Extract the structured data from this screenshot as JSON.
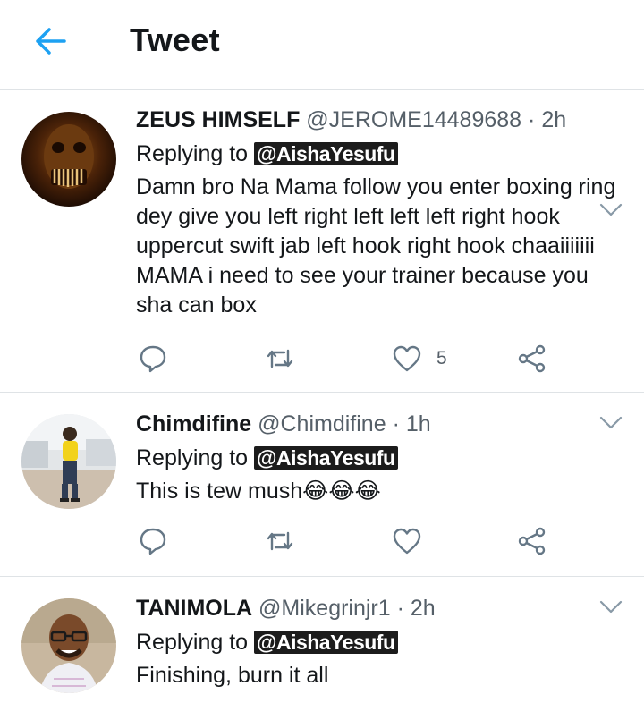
{
  "header": {
    "title": "Tweet"
  },
  "tweets": [
    {
      "name": "ZEUS HIMSELF",
      "handle": "@JEROME14489688",
      "separator": "·",
      "time": "2h",
      "replying_label": "Replying to",
      "replying_to": "@AishaYesufu",
      "text": "Damn bro Na Mama follow you enter boxing ring dey give you left right left left left right hook uppercut swift jab left hook right hook chaaiiiiiii MAMA i need to see your trainer because you sha can box",
      "like_count": "5"
    },
    {
      "name": "Chimdifine",
      "handle": "@Chimdifine",
      "separator": "·",
      "time": "1h",
      "replying_label": "Replying to",
      "replying_to": "@AishaYesufu",
      "text": "This is tew mush😂😂😂",
      "like_count": ""
    },
    {
      "name": "TANIMOLA",
      "handle": "@Mikegrinjr1",
      "separator": "·",
      "time": "2h",
      "replying_label": "Replying to",
      "replying_to": "@AishaYesufu",
      "text": "Finishing, burn it all"
    }
  ],
  "colors": {
    "accent": "#1da1f2",
    "icon": "#657786",
    "divider": "#dfe3e6"
  },
  "icons": [
    "back-arrow-icon",
    "chevron-down-icon",
    "reply-icon",
    "retweet-icon",
    "like-icon",
    "share-icon"
  ]
}
